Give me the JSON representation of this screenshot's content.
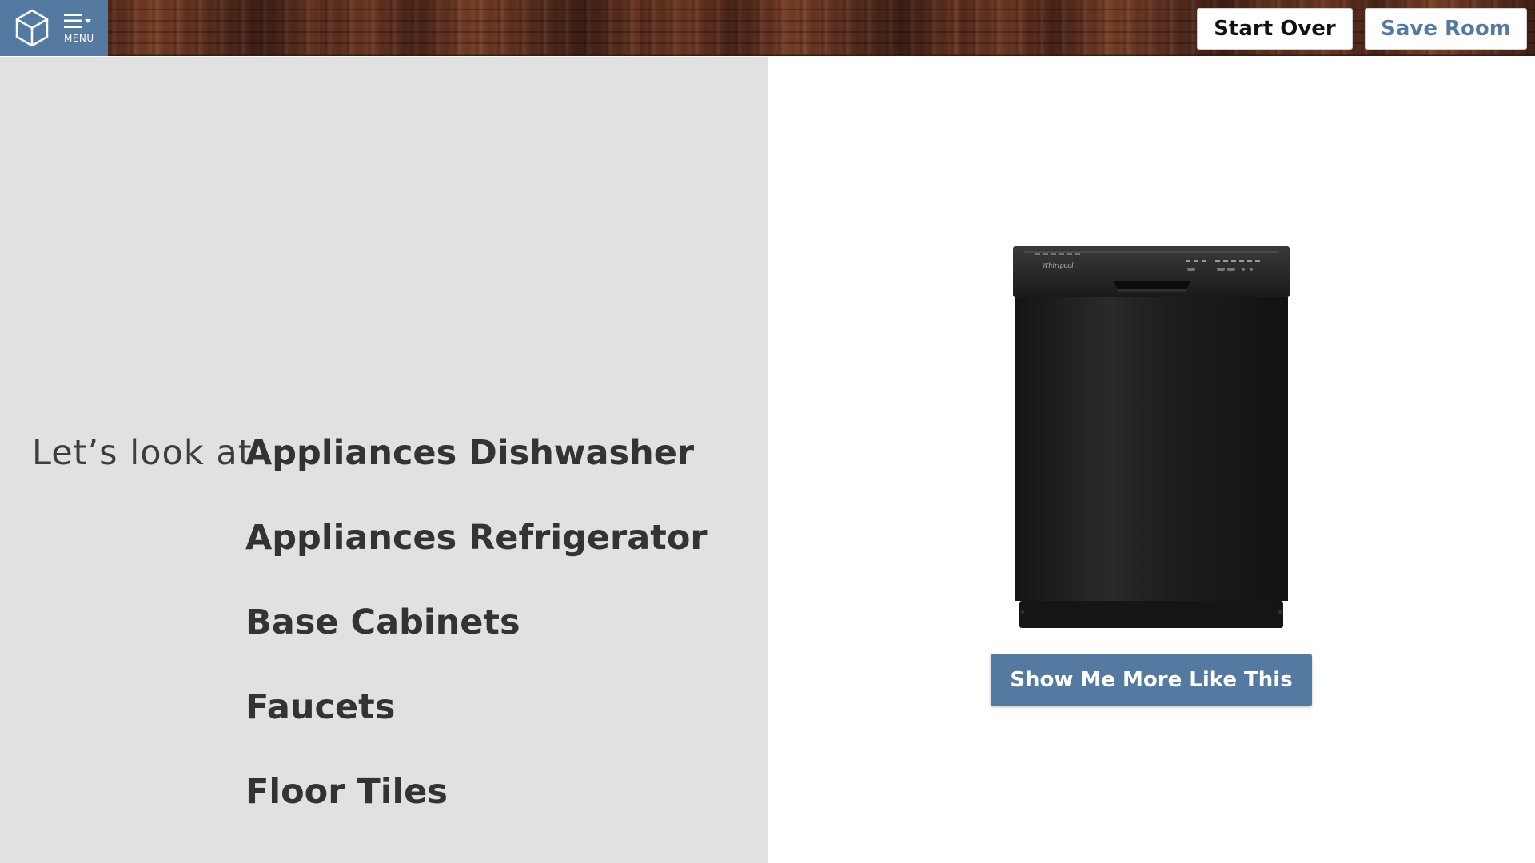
{
  "menu": {
    "label": "MENU",
    "logo_icon": "cube-logo-icon",
    "hamburger_icon": "hamburger-dropdown-icon",
    "background_color": "#557aa1"
  },
  "header": {
    "start_over_label": "Start Over",
    "save_room_label": "Save Room",
    "accent_color": "#557aa1"
  },
  "selector": {
    "prompt": "Let’s look at",
    "categories": [
      "Appliances Dishwasher",
      "Appliances Refrigerator",
      "Base Cabinets",
      "Faucets",
      "Floor Tiles"
    ]
  },
  "product": {
    "image": "black-dishwasher-image",
    "brand_mark": "Whirlpool",
    "show_more_label": "Show Me More Like This"
  }
}
